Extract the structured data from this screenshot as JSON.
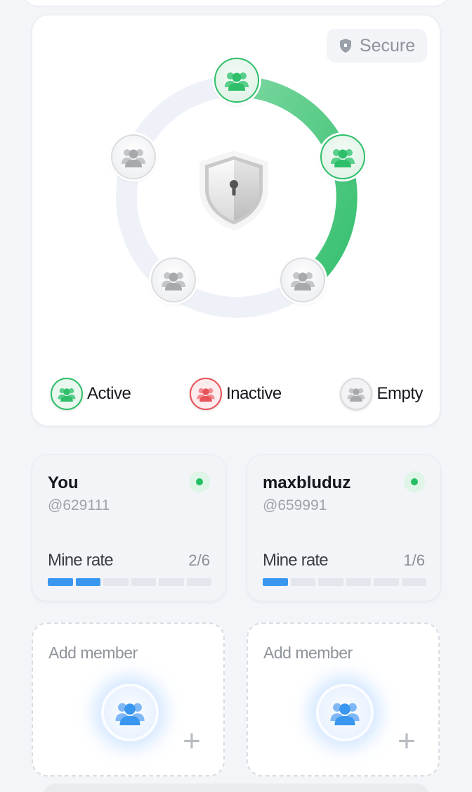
{
  "circle": {
    "secure_label": "Secure",
    "nodes": [
      {
        "state": "active",
        "icon": "users-icon"
      },
      {
        "state": "active",
        "icon": "users-icon"
      },
      {
        "state": "empty",
        "icon": "users-icon"
      },
      {
        "state": "empty",
        "icon": "users-icon"
      },
      {
        "state": "empty",
        "icon": "users-icon"
      }
    ],
    "center_icon": "shield-lock-icon",
    "legend": [
      {
        "label": "Active",
        "color": "#2fbf6a"
      },
      {
        "label": "Inactive",
        "color": "#e8535a"
      },
      {
        "label": "Empty",
        "color": "#c9cbd0"
      }
    ],
    "progress_color": "#3cc374"
  },
  "members": [
    {
      "name": "You",
      "handle": "@629111",
      "status": "online",
      "mine_label": "Mine rate",
      "mine_value": "2/6",
      "filled": 2,
      "total": 6
    },
    {
      "name": "maxbluduz",
      "handle": "@659991",
      "status": "online",
      "mine_label": "Mine rate",
      "mine_value": "1/6",
      "filled": 1,
      "total": 6
    }
  ],
  "add_slots": [
    {
      "label": "Add member",
      "plus": "+"
    },
    {
      "label": "Add member",
      "plus": "+"
    }
  ],
  "colors": {
    "accent_blue": "#3a97ef",
    "online_green": "#22c063"
  }
}
